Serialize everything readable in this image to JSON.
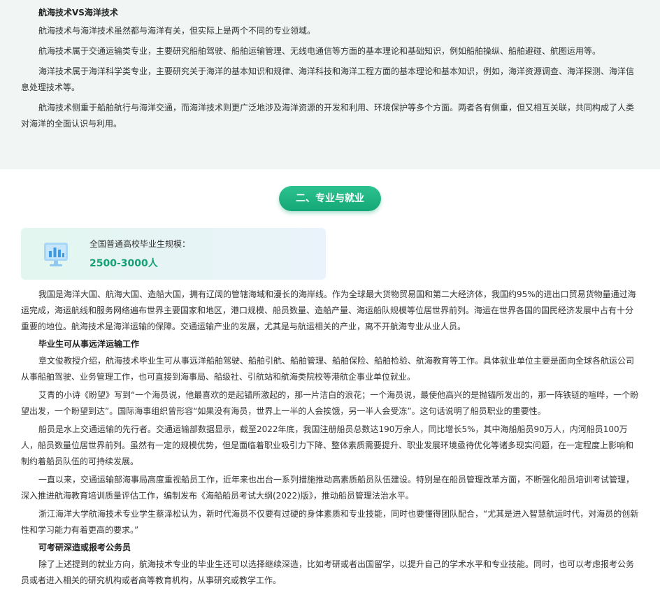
{
  "intro": {
    "title": "航海技术VS海洋技术",
    "paragraphs": [
      "航海技术与海洋技术虽然都与海洋有关，但实际上是两个不同的专业领域。",
      "航海技术属于交通运输类专业，主要研究船舶驾驶、船舶运输管理、无线电通信等方面的基本理论和基础知识，例如船舶操纵、船舶避碰、航图运用等。",
      "海洋技术属于海洋科学类专业，主要研究关于海洋的基本知识和规律、海洋科技和海洋工程方面的基本理论和基本知识，例如，海洋资源调查、海洋探测、海洋信息处理技术等。",
      "航海技术侧重于船舶航行与海洋交通，而海洋技术则更广泛地涉及海洋资源的开发和利用、环境保护等多个方面。两者各有侧重，但又相互关联，共同构成了人类对海洋的全面认识与利用。"
    ]
  },
  "section": {
    "tag": "二、专业与就业"
  },
  "stat": {
    "icon": "bar-chart-monitor-icon",
    "label": "全国普通高校毕业生规模：",
    "value": "2500-3000人"
  },
  "body": {
    "p1": "我国是海洋大国、航海大国、造船大国，拥有辽阔的管辖海域和漫长的海岸线。作为全球最大货物贸易国和第二大经济体，我国约95%的进出口贸易货物量通过海运完成，海运航线和服务网络遍布世界主要国家和地区，港口规模、船员数量、造船产量、海运船队规模等位居世界前列。海运在世界各国的国民经济发展中占有十分重要的地位。航海技术是海洋运输的保障。交通运输产业的发展，尤其是与航运相关的产业，离不开航海专业从业人员。",
    "h1": "毕业生可从事远洋运输工作",
    "p2": "章文俊教授介绍，航海技术毕业生可从事远洋船舶驾驶、船舶引航、船舶管理、船舶保险、船舶检验、航海教育等工作。具体就业单位主要是面向全球各航运公司从事船舶驾驶、业务管理工作，也可直接到海事局、船级社、引航站和航海类院校等港航企事业单位就业。",
    "p3": "艾青的小诗《盼望》写到“一个海员说，他最喜欢的是起锚所激起的，那一片洁白的浪花；一个海员说，最使他高兴的是抛锚所发出的，那一阵铁链的喧哗，一个盼望出发，一个盼望到达”。国际海事组织曾形容“如果没有海员，世界上一半的人会挨饿，另一半人会受冻”。这句话说明了船员职业的重要性。",
    "p4": "船员是水上交通运输的先行者。交通运输部数据显示，截至2022年底，我国注册船员总数达190万余人，同比增长5%，其中海船船员90万人，内河船员100万人，船员数量位居世界前列。虽然有一定的规模优势，但是面临着职业吸引力下降、整体素质需要提升、职业发展环境亟待优化等诸多现实问题，在一定程度上影响和制约着船员队伍的可持续发展。",
    "p5": "一直以来，交通运输部海事局高度重视船员工作，近年来也出台一系列措施推动高素质船员队伍建设。特别是在船员管理改革方面，不断强化船员培训考试管理，深入推进航海教育培训质量评估工作，编制发布《海船船员考试大纲(2022)版》，推动船员管理法治水平。",
    "p6": "浙江海洋大学航海技术专业学生蔡泽松认为，新时代海员不仅要有过硬的身体素质和专业技能，同时也要懂得团队配合，“尤其是进入智慧航运时代，对海员的创新性和学习能力有着更高的要求。”",
    "h2": "可考研深造或报考公务员",
    "p7": "除了上述提到的就业方向，航海技术专业的毕业生还可以选择继续深造，比如考研或者出国留学，以提升自己的学术水平和专业技能。同时，也可以考虑报考公务员或者进入相关的研究机构或者高等教育机构，从事研究或教学工作。"
  },
  "colors": {
    "accent": "#14a777",
    "stat_value": "#16a074",
    "top_bg": "#f1f6f5"
  }
}
